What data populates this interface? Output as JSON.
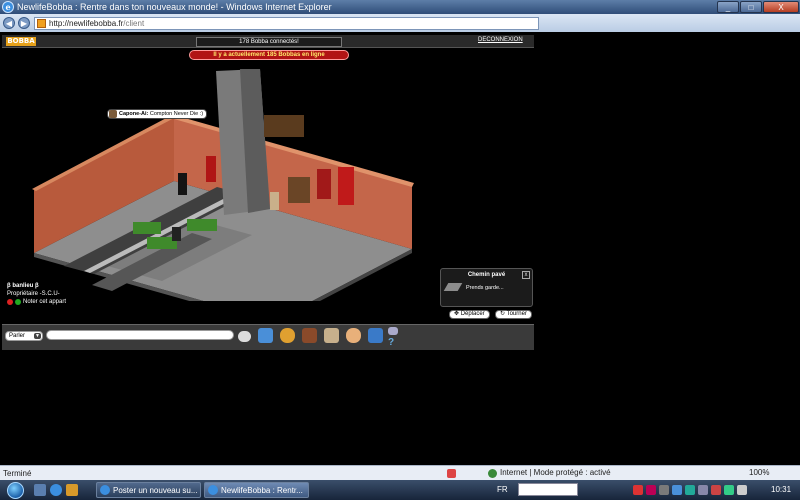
{
  "window": {
    "title": "NewlifeBobba : Rentre dans ton nouveaux monde! - Windows Internet Explorer",
    "minimize": "_",
    "maximize": "□",
    "close": "X"
  },
  "address": {
    "host": "http://newlifebobba.fr",
    "path": "/client"
  },
  "client": {
    "logo": "BOBBA",
    "connected": "178 Bobba connectés!",
    "logout": "DECONNEXION",
    "online_banner": "Il y a actuellement 185 Bobbas en ligne"
  },
  "chat_bubble": {
    "user": "Capone-Ai:",
    "message": "Compton Never Die :)"
  },
  "room_info": {
    "name": "β banlieu β",
    "owner": "Propriétaire -S.C.U-",
    "rate_label": "Noter cet appart"
  },
  "furni": {
    "name": "Chemin pavé",
    "description": "Prends garde...",
    "close": "x",
    "move_button": "Déplacer",
    "rotate_button": "Tourner"
  },
  "toolbar": {
    "speak_mode": "Parler",
    "chat_placeholder": ""
  },
  "status_bar": {
    "left": "Terminé",
    "zone": "Internet | Mode protégé : activé",
    "zoom": "100%"
  },
  "taskbar": {
    "tasks": [
      "Poster un nouveau su...",
      "NewlifeBobba : Rentr..."
    ],
    "lang": "FR",
    "clock": "10:31"
  },
  "colors": {
    "wall": "#b85a3c",
    "floor": "#8e8e8e",
    "banner": "#b11414",
    "taskbar": "#1f2f48"
  }
}
